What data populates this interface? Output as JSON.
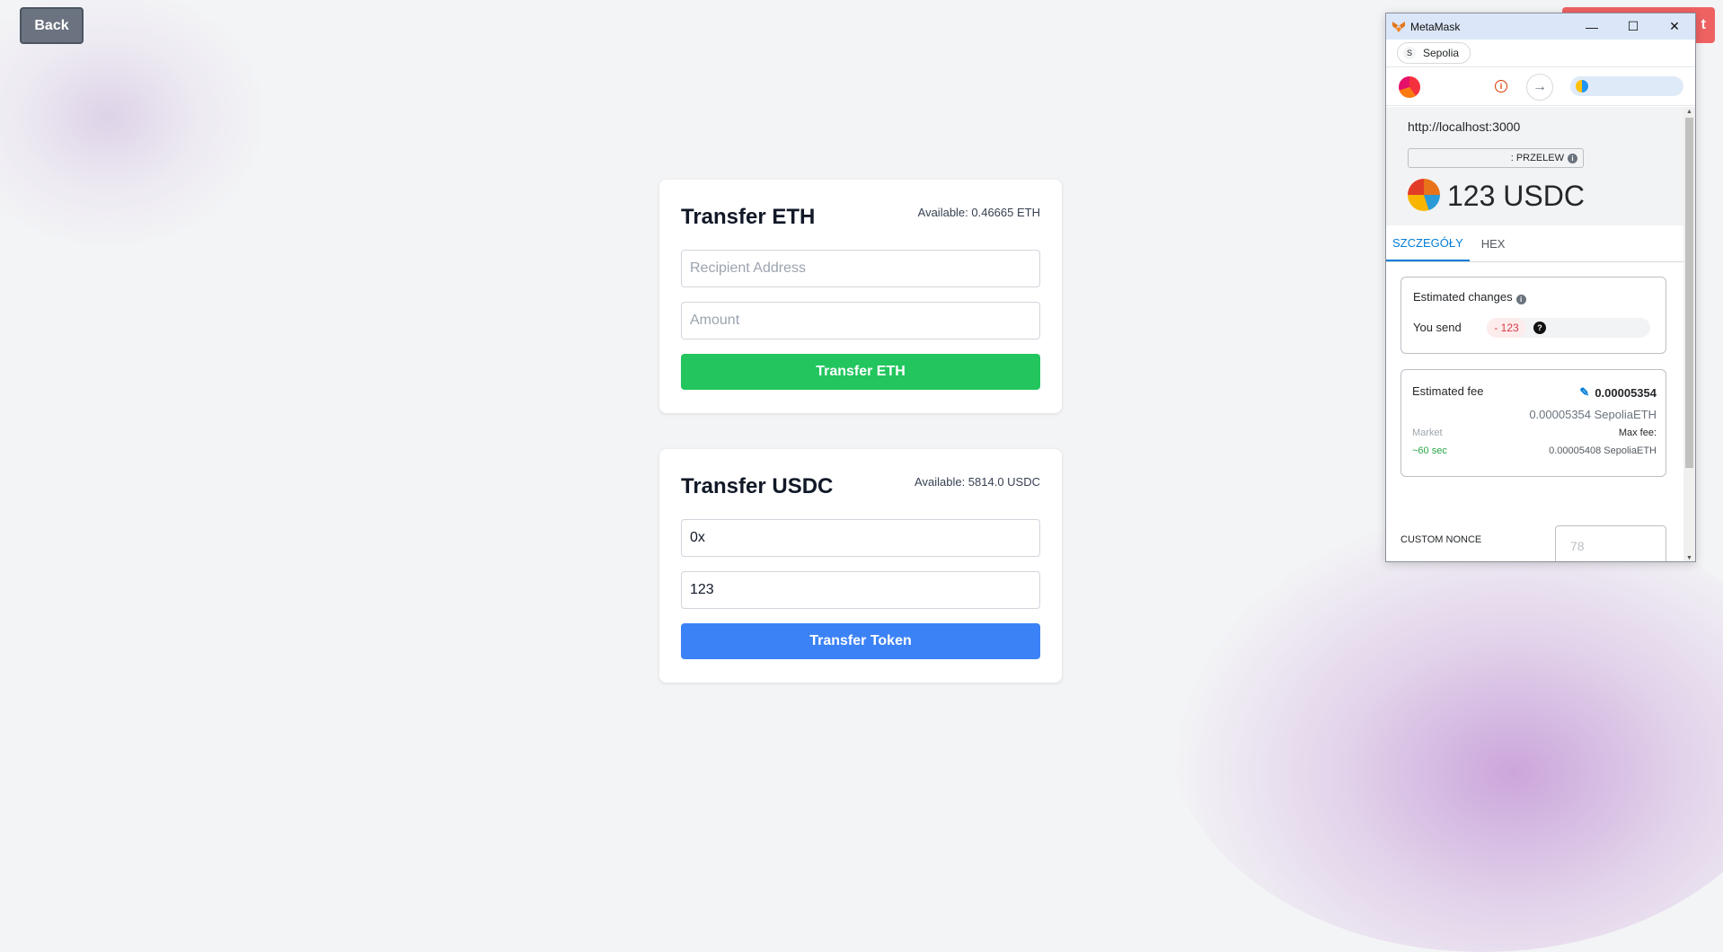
{
  "page": {
    "back_label": "Back",
    "red_button_label": "t"
  },
  "eth_card": {
    "title": "Transfer ETH",
    "available": "Available: 0.46665 ETH",
    "recipient_placeholder": "Recipient Address",
    "amount_placeholder": "Amount",
    "button_label": "Transfer ETH",
    "button_color": "#22c55e"
  },
  "usdc_card": {
    "title": "Transfer USDC",
    "available": "Available: 5814.0 USDC",
    "recipient_value": "0x",
    "amount_value": "123",
    "button_label": "Transfer Token",
    "button_color": "#3b82f6"
  },
  "metamask": {
    "window_title": "MetaMask",
    "controls": {
      "minimize": "—",
      "maximize": "☐",
      "close": "✕"
    },
    "network_initial": "S",
    "network": "Sepolia",
    "info_icon": "info-icon",
    "arrow_glyph": "→",
    "origin": "http://localhost:3000",
    "method": ": PRZELEW",
    "info_glyph": "i",
    "amount": "123 USDC",
    "tabs": [
      "SZCZEGÓŁY",
      "HEX"
    ],
    "estimated_changes_label": "Estimated changes",
    "you_send_label": "You send",
    "you_send_value": "- 123",
    "question_glyph": "?",
    "estimated_fee_label": "Estimated fee",
    "pencil_glyph": "✎",
    "fee_value": "0.00005354",
    "fee_sub": "0.00005354 SepoliaETH",
    "market_label": "Market",
    "max_fee_label": "Max fee:",
    "time_label": "~60 sec",
    "max_fee_value": "0.00005408 SepoliaETH",
    "custom_nonce_label": "CUSTOM NONCE",
    "nonce_placeholder": "78",
    "accent_color": "#037dd6"
  }
}
